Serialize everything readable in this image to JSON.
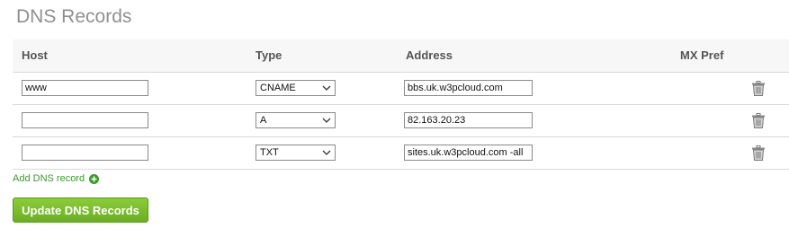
{
  "page": {
    "title": "DNS Records"
  },
  "table": {
    "headers": {
      "host": "Host",
      "type": "Type",
      "address": "Address",
      "mx_pref": "MX Pref"
    },
    "rows": [
      {
        "host": "www",
        "type": "CNAME",
        "address": "bbs.uk.w3pcloud.com",
        "delete_icon": "trash-icon"
      },
      {
        "host": "",
        "type": "A",
        "address": "82.163.20.23",
        "delete_icon": "trash-icon"
      },
      {
        "host": "",
        "type": "TXT",
        "address": "sites.uk.w3pcloud.com -all",
        "delete_icon": "trash-icon"
      }
    ]
  },
  "actions": {
    "add_record_label": "Add DNS record",
    "add_record_icon": "plus-circle-icon",
    "update_button_label": "Update DNS Records"
  },
  "colors": {
    "accent_green": "#6cae24",
    "link_green": "#3a9a2a",
    "title_gray": "#8f8f8f"
  }
}
